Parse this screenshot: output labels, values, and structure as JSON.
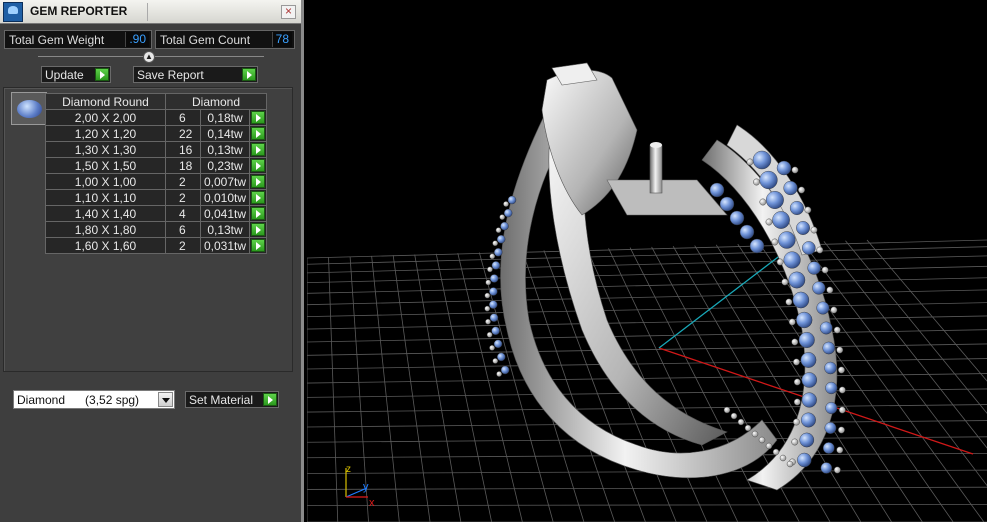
{
  "window": {
    "title": "GEM REPORTER",
    "close_glyph": "×"
  },
  "stats": {
    "weight_label": "Total Gem Weight",
    "weight_value": ".90",
    "count_label": "Total Gem Count",
    "count_value": "78"
  },
  "buttons": {
    "update": "Update",
    "save_report": "Save Report",
    "set_material": "Set Material"
  },
  "table": {
    "headers": [
      "Diamond Round",
      "Diamond"
    ],
    "rows": [
      {
        "size": "2,00 X 2,00",
        "count": "6",
        "tw": "0,18tw"
      },
      {
        "size": "1,20 X 1,20",
        "count": "22",
        "tw": "0,14tw"
      },
      {
        "size": "1,30 X 1,30",
        "count": "16",
        "tw": "0,13tw"
      },
      {
        "size": "1,50 X 1,50",
        "count": "18",
        "tw": "0,23tw"
      },
      {
        "size": "1,00 X 1,00",
        "count": "2",
        "tw": "0,007tw"
      },
      {
        "size": "1,10 X 1,10",
        "count": "2",
        "tw": "0,010tw"
      },
      {
        "size": "1,40 X 1,40",
        "count": "4",
        "tw": "0,041tw"
      },
      {
        "size": "1,80 X 1,80",
        "count": "6",
        "tw": "0,13tw"
      },
      {
        "size": "1,60 X 1,60",
        "count": "2",
        "tw": "0,031tw"
      }
    ]
  },
  "material": {
    "selected": "Diamond      (3,52 spg)"
  },
  "viewport": {
    "axis_labels": {
      "z": "z",
      "y": "y",
      "x": "x"
    },
    "colors": {
      "grid": "#5a5a5a",
      "x_axis": "#d01818",
      "y_axis": "#18a8b8",
      "metal": "#c8c8c8",
      "gem": "#6f93d8"
    }
  }
}
